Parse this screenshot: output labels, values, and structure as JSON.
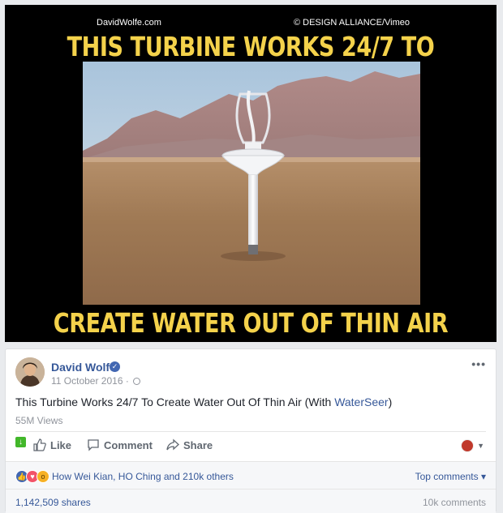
{
  "video": {
    "watermark_left": "DavidWolfe.com",
    "watermark_right": "© DESIGN ALLIANCE/Vimeo",
    "headline_top": "THIS TURBINE WORKS 24/7 TO",
    "headline_bottom": "CREATE WATER OUT OF THIN AIR"
  },
  "post": {
    "author": "David Wolfe",
    "date": "11 October 2016 ·",
    "text_prefix": "This Turbine Works 24/7 To Create Water Out Of Thin Air (With ",
    "text_link": "WaterSeer",
    "text_suffix": ")",
    "views": "55M Views",
    "more_icon": "•••"
  },
  "actions": {
    "like": "Like",
    "comment": "Comment",
    "share": "Share"
  },
  "reactions": {
    "summary": "How Wei Kian, HO Ching and 210k others",
    "top_comments": "Top comments ▾"
  },
  "counts": {
    "shares": "1,142,509 shares",
    "comments": "10k comments"
  },
  "colors": {
    "headline": "#f4d24b",
    "link": "#365899",
    "background": "#e9ebee"
  }
}
